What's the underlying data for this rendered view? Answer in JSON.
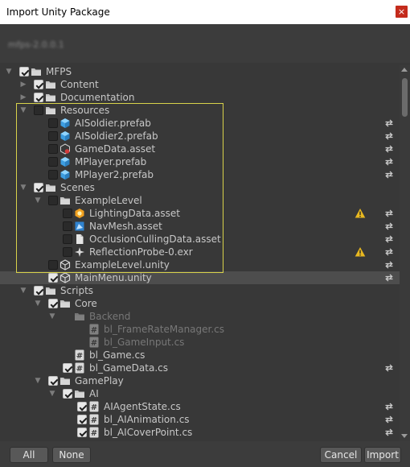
{
  "window": {
    "title": "Import Unity Package",
    "close_glyph": "×"
  },
  "package": {
    "name": "mfps-2.0.0.1"
  },
  "tree": [
    {
      "label": "MFPS",
      "level": 0,
      "arrow": "down",
      "checked": true,
      "icon": "folder-icon"
    },
    {
      "label": "Content",
      "level": 1,
      "arrow": "right",
      "checked": true,
      "icon": "folder-icon"
    },
    {
      "label": "Documentation",
      "level": 1,
      "arrow": "right",
      "checked": true,
      "icon": "folder-icon"
    },
    {
      "label": "Resources",
      "level": 1,
      "arrow": "down",
      "checked": false,
      "icon": "folder-icon"
    },
    {
      "label": "AISoldier.prefab",
      "level": 2,
      "checked": false,
      "icon": "prefab-icon",
      "refresh": true
    },
    {
      "label": "AISoldier2.prefab",
      "level": 2,
      "checked": false,
      "icon": "prefab-icon",
      "refresh": true
    },
    {
      "label": "GameData.asset",
      "level": 2,
      "checked": false,
      "icon": "scriptable-object-icon",
      "refresh": true
    },
    {
      "label": "MPlayer.prefab",
      "level": 2,
      "checked": false,
      "icon": "prefab-icon",
      "refresh": true
    },
    {
      "label": "MPlayer2.prefab",
      "level": 2,
      "checked": false,
      "icon": "prefab-icon",
      "refresh": true
    },
    {
      "label": "Scenes",
      "level": 1,
      "arrow": "down",
      "checked": true,
      "icon": "folder-icon"
    },
    {
      "label": "ExampleLevel",
      "level": 2,
      "arrow": "down",
      "checked": false,
      "icon": "folder-icon"
    },
    {
      "label": "LightingData.asset",
      "level": 3,
      "checked": false,
      "icon": "lighting-data-icon",
      "refresh": true,
      "warning": true
    },
    {
      "label": "NavMesh.asset",
      "level": 3,
      "checked": false,
      "icon": "navmesh-icon",
      "refresh": true
    },
    {
      "label": "OcclusionCullingData.asset",
      "level": 3,
      "checked": false,
      "icon": "file-icon",
      "refresh": true
    },
    {
      "label": "ReflectionProbe-0.exr",
      "level": 3,
      "checked": false,
      "icon": "reflection-probe-icon",
      "refresh": true,
      "warning": true
    },
    {
      "label": "ExampleLevel.unity",
      "level": 2,
      "checked": false,
      "icon": "unity-scene-icon",
      "refresh": true
    },
    {
      "label": "MainMenu.unity",
      "level": 2,
      "checked": true,
      "icon": "unity-scene-icon",
      "refresh": true,
      "selected": true
    },
    {
      "label": "Scripts",
      "level": 1,
      "arrow": "down",
      "checked": true,
      "icon": "folder-icon"
    },
    {
      "label": "Core",
      "level": 2,
      "arrow": "down",
      "checked": true,
      "icon": "folder-icon"
    },
    {
      "label": "Backend",
      "level": 3,
      "arrow": "down",
      "icon": "folder-icon",
      "disabled": true
    },
    {
      "label": "bl_FrameRateManager.cs",
      "level": 4,
      "icon": "cs-script-icon",
      "disabled": true
    },
    {
      "label": "bl_GameInput.cs",
      "level": 4,
      "icon": "cs-script-icon",
      "disabled": true
    },
    {
      "label": "bl_Game.cs",
      "level": 3,
      "icon": "cs-script-icon"
    },
    {
      "label": "bl_GameData.cs",
      "level": 3,
      "checked": true,
      "icon": "cs-script-icon",
      "refresh": true
    },
    {
      "label": "GamePlay",
      "level": 2,
      "arrow": "down",
      "checked": true,
      "icon": "folder-icon"
    },
    {
      "label": "AI",
      "level": 3,
      "arrow": "down",
      "checked": true,
      "icon": "folder-icon"
    },
    {
      "label": "AIAgentState.cs",
      "level": 4,
      "checked": true,
      "icon": "cs-script-icon",
      "refresh": true
    },
    {
      "label": "bl_AIAnimation.cs",
      "level": 4,
      "checked": true,
      "icon": "cs-script-icon",
      "refresh": true
    },
    {
      "label": "bl_AICoverPoint.cs",
      "level": 4,
      "checked": true,
      "icon": "cs-script-icon",
      "refresh": true
    }
  ],
  "footer": {
    "all_label": "All",
    "none_label": "None",
    "cancel_label": "Cancel",
    "import_label": "Import"
  },
  "colors": {
    "background": "#383838",
    "highlight_border": "#d8d24a",
    "close_button": "#c42b1c",
    "warning": "#e8b820",
    "prefab": "#57b8f0"
  }
}
